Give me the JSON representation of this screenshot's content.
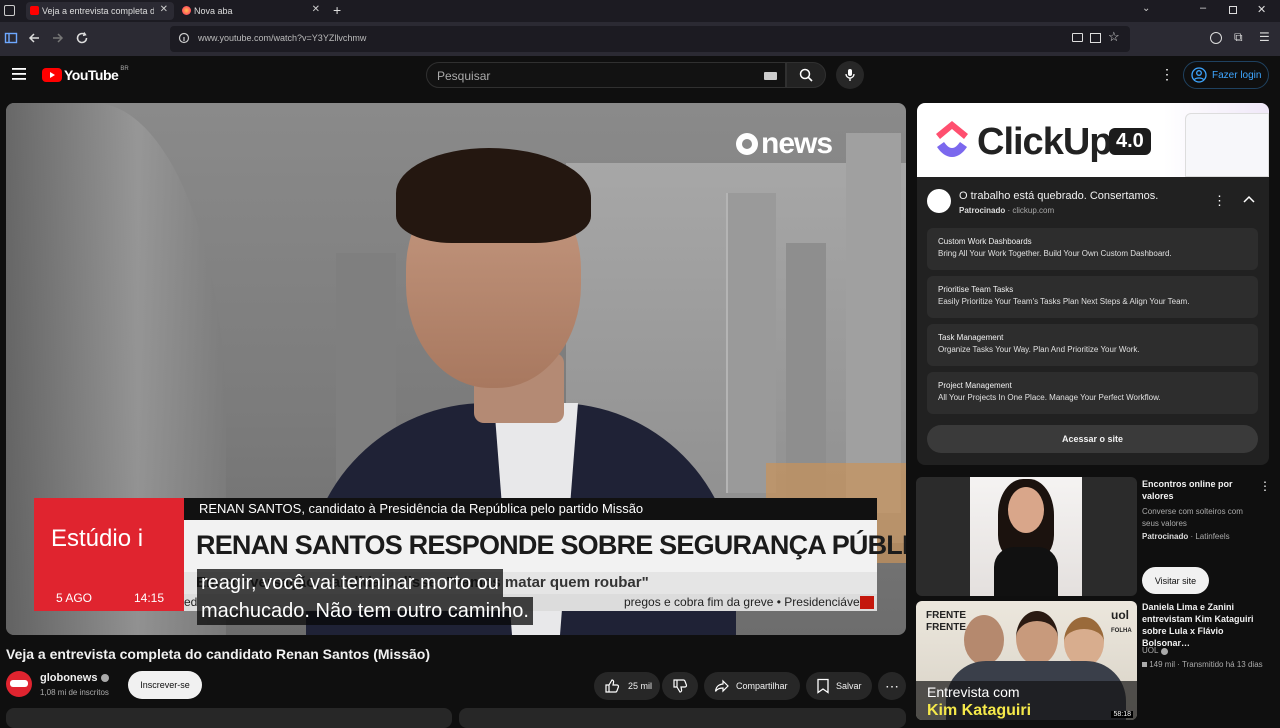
{
  "browser": {
    "tabs": [
      {
        "title": "Veja a entrevista completa do c",
        "active": true
      },
      {
        "title": "Nova aba",
        "active": false
      }
    ],
    "url": "www.youtube.com/watch?v=Y3YZllvchmw"
  },
  "header": {
    "logo": "YouTube",
    "region": "BR",
    "search_placeholder": "Pesquisar",
    "signin_label": "Fazer login"
  },
  "video": {
    "channel_overlay": "news",
    "lower_third": {
      "brand": "Estúdio i",
      "date": "5 AGO",
      "time": "14:15",
      "name_line": "RENAN SANTOS, candidato à Presidência da República pelo partido Missão",
      "headline": "RENAN SANTOS RESPONDE SOBRE SEGURANÇA PÚBLICA",
      "subline_partial": "Em conversação, candidato disse: \"vamos matar quem roubar\"",
      "ticker": "pregos e cobra fim da greve  •  Presidenciáveis",
      "ticker_prefix": "ed"
    },
    "captions": [
      "reagir, você vai terminar morto ou",
      "machucado. Não tem outro caminho."
    ]
  },
  "below_video": {
    "title": "Veja a entrevista completa do candidato Renan Santos (Missão)",
    "channel_name": "globonews",
    "subscribers": "1,08 mi de inscritos",
    "subscribe_label": "Inscrever-se",
    "likes": "25 mil",
    "share_label": "Compartilhar",
    "save_label": "Salvar"
  },
  "ad": {
    "banner_brand": "ClickUp",
    "banner_version": "4.0",
    "headline": "O trabalho está quebrado. Consertamos.",
    "sponsored": "Patrocinado",
    "domain": "clickup.com",
    "items": [
      {
        "title": "Custom Work Dashboards",
        "desc": "Bring All Your Work Together. Build Your Own Custom Dashboard."
      },
      {
        "title": "Prioritise Team Tasks",
        "desc": "Easily Prioritize Your Team's Tasks Plan Next Steps & Align Your Team."
      },
      {
        "title": "Task Management",
        "desc": "Organize Tasks Your Way. Plan And Prioritize Your Work."
      },
      {
        "title": "Project Management",
        "desc": "All Your Projects In One Place. Manage Your Perfect Workflow."
      }
    ],
    "cta": "Acessar o site"
  },
  "sidebar": {
    "ad2": {
      "title": "Encontros online por valores",
      "desc": "Converse com solteiros com seus valores",
      "sponsored": "Patrocinado",
      "advertiser": "Latinfeels",
      "cta": "Visitar site"
    },
    "video1": {
      "title": "Daniela Lima e Zanini entrevistam Kim Kataguiri sobre Lula x Flávio Bolsonar…",
      "channel": "UOL",
      "views": "149 mil",
      "age": "Transmitido há 13 dias",
      "thumb_line1": "Entrevista com",
      "thumb_line2": "Kim Kataguiri",
      "thumb_badge_top": "FRENTE",
      "thumb_badge_bottom": "FRENTE",
      "thumb_brand": "uol",
      "thumb_subbrand": "FOLHA",
      "duration": "58:18"
    }
  }
}
